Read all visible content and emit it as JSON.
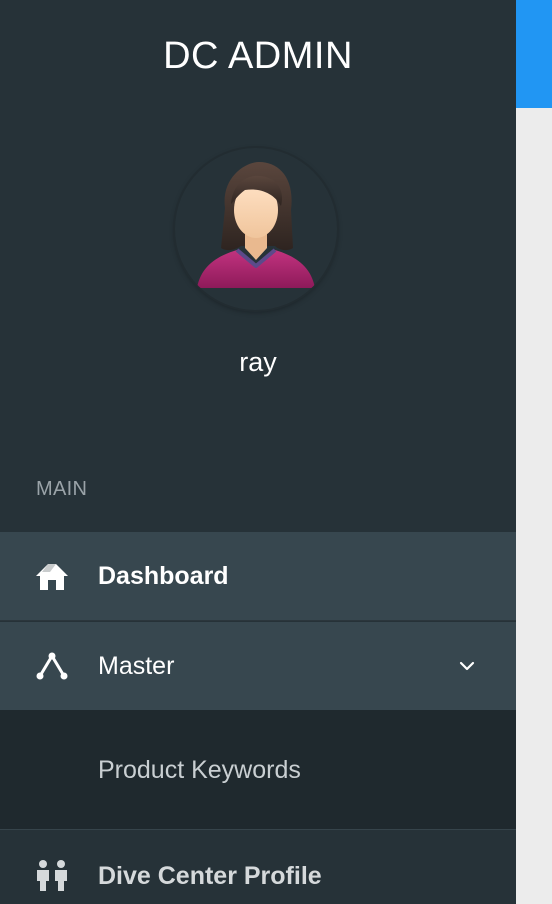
{
  "sidebar": {
    "brand": "DC ADMIN",
    "user": {
      "name": "ray",
      "avatar_icon": "female-user-avatar-icon"
    },
    "section_label": "MAIN",
    "items": [
      {
        "label": "Dashboard",
        "icon": "home-icon",
        "active": true
      },
      {
        "label": "Master",
        "icon": "branch-icon",
        "expanded": true,
        "chevron_icon": "chevron-down-icon",
        "children": [
          {
            "label": "Product Keywords"
          }
        ]
      },
      {
        "label": "Dive Center Profile",
        "icon": "people-icon"
      }
    ]
  },
  "colors": {
    "sidebar_bg": "#263238",
    "active_item_bg": "#37474f",
    "submenu_bg": "#1f292e",
    "accent": "#2196f3",
    "content_bg": "#ececec"
  }
}
